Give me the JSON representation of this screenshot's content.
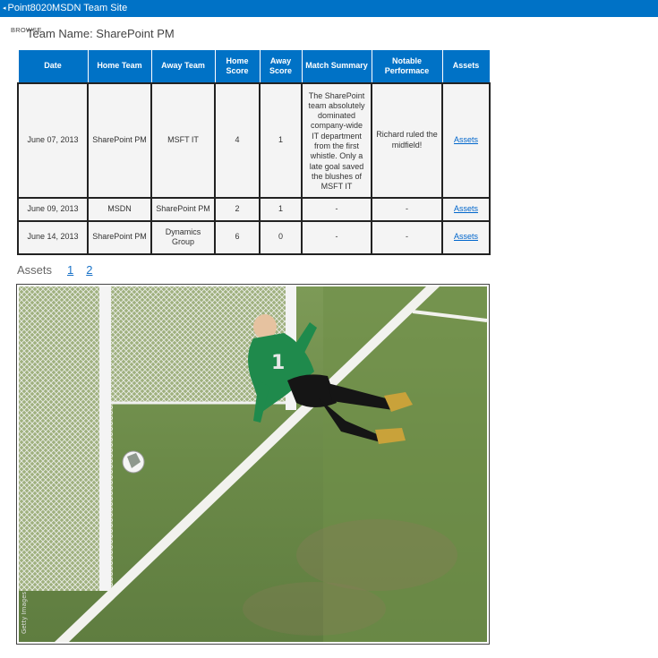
{
  "suitebar": {
    "back_icon": "◂",
    "site_title": "Point8020MSDN Team Site"
  },
  "ribbon": {
    "browse_tab": "BROWSE"
  },
  "page": {
    "team_name": "Team Name: SharePoint PM"
  },
  "table": {
    "headers": [
      "Date",
      "Home Team",
      "Away Team",
      "Home Score",
      "Away Score",
      "Match Summary",
      "Notable Performace",
      "Assets"
    ],
    "rows": [
      {
        "date": "June 07, 2013",
        "home": "SharePoint PM",
        "away": "MSFT IT",
        "home_score": "4",
        "away_score": "1",
        "summary": "The SharePoint team absolutely dominated company-wide IT department from the first whistle. Only a late goal saved the blushes of MSFT IT",
        "notable": "Richard ruled the midfield!",
        "assets": "Assets"
      },
      {
        "date": "June 09, 2013",
        "home": "MSDN",
        "away": "SharePoint PM",
        "home_score": "2",
        "away_score": "1",
        "summary": "-",
        "notable": "-",
        "assets": "Assets"
      },
      {
        "date": "June 14, 2013",
        "home": "SharePoint PM",
        "away": "Dynamics Group",
        "home_score": "6",
        "away_score": "0",
        "summary": "-",
        "notable": "-",
        "assets": "Assets"
      }
    ]
  },
  "assets_section": {
    "label": "Assets",
    "pages": [
      "1",
      "2"
    ]
  },
  "photo": {
    "watermark": "Getty Images"
  }
}
